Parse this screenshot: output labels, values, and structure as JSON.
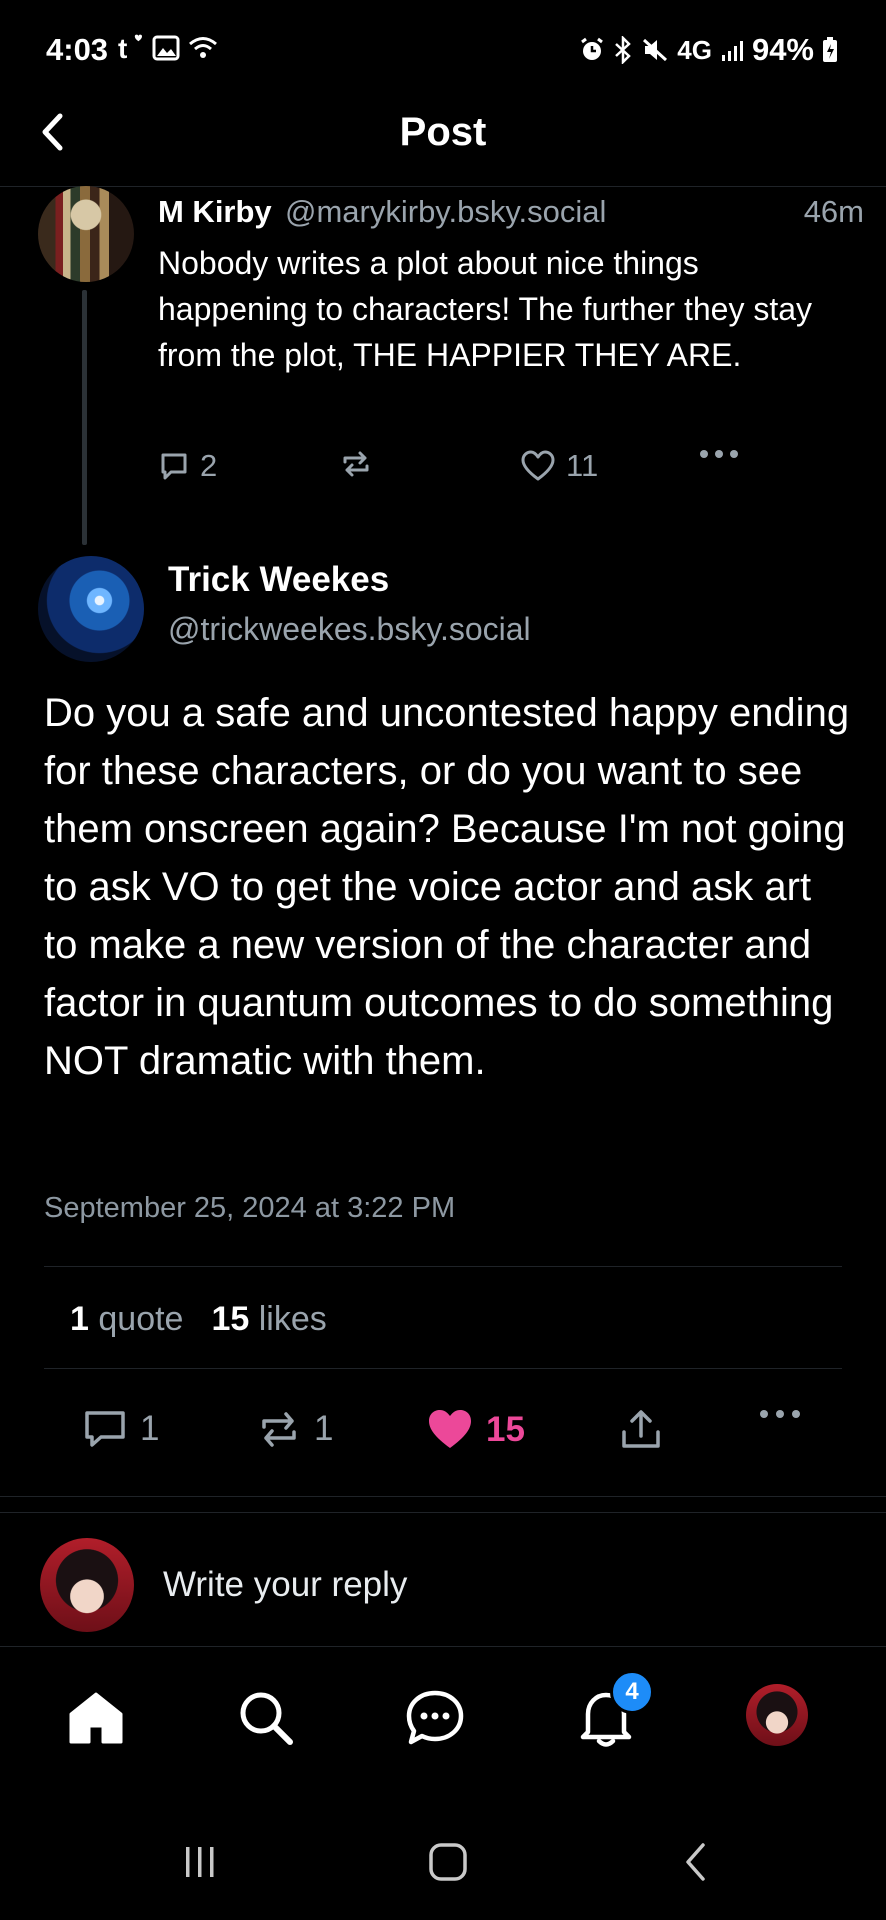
{
  "status_bar": {
    "time": "4:03",
    "network": "4G",
    "battery": "94%"
  },
  "header": {
    "title": "Post"
  },
  "parent_post": {
    "author_name": "M Kirby",
    "author_handle": "@marykirby.bsky.social",
    "time_ago": "46m",
    "text": "Nobody writes a plot about nice things happening to characters! The further they stay from the plot, THE HAPPIER THEY ARE.",
    "replies": "2",
    "likes": "11"
  },
  "main_post": {
    "author_name": "Trick Weekes",
    "author_handle": "@trickweekes.bsky.social",
    "text": "Do you a safe and uncontested happy ending for these characters, or do you want to see them onscreen again? Because I'm not going to ask VO to get the voice actor and ask art to make a new version of the character and factor in quantum outcomes to do something NOT dramatic with them.",
    "date": "September 25, 2024 at 3:22 PM",
    "quote_count": "1",
    "quote_label": "quote",
    "like_count": "15",
    "like_label": "likes",
    "replies": "1",
    "reposts": "1",
    "likes": "15"
  },
  "reply": {
    "placeholder": "Write your reply"
  },
  "bottom_nav": {
    "notifications_badge": "4"
  },
  "colors": {
    "like_active": "#ec4899",
    "secondary_text": "#9aa4ad",
    "badge": "#1d8cf8"
  }
}
